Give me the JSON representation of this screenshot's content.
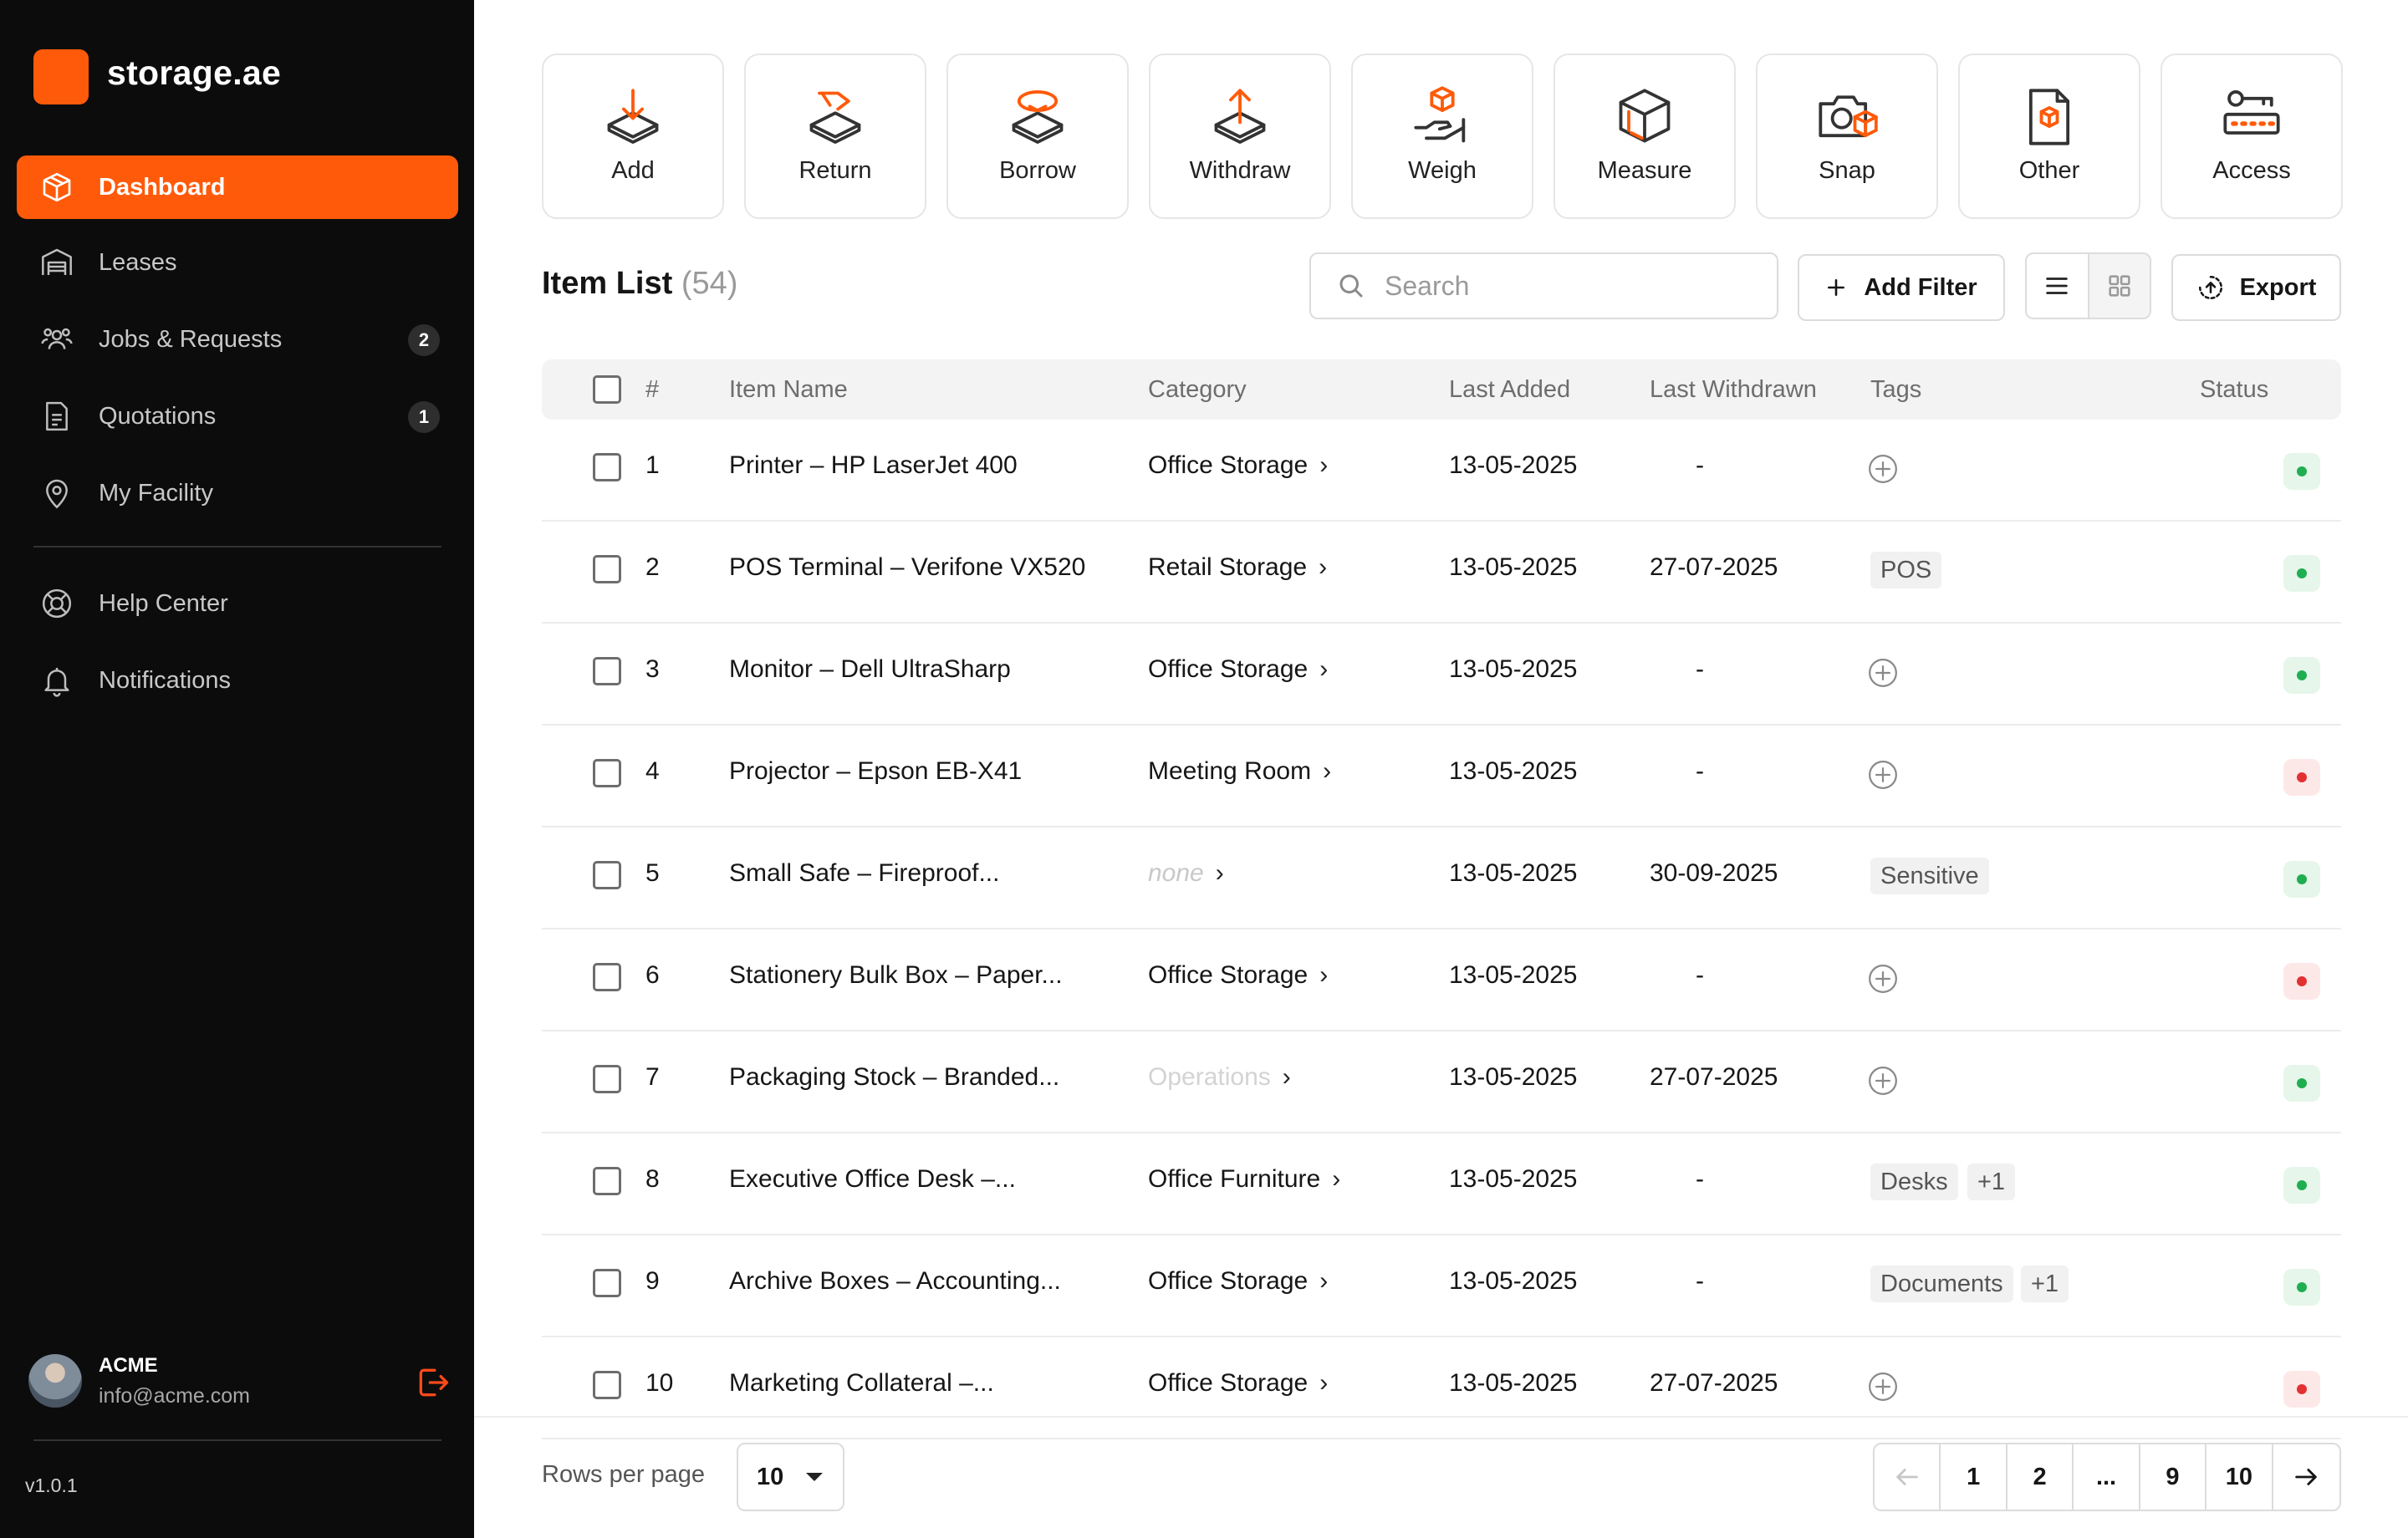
{
  "brand": {
    "name": "storage.ae",
    "accent": "#ff5a0a"
  },
  "sidebar": {
    "items": [
      {
        "label": "Dashboard",
        "icon": "box-icon",
        "active": true
      },
      {
        "label": "Leases",
        "icon": "warehouse-icon"
      },
      {
        "label": "Jobs & Requests",
        "icon": "people-icon",
        "badge": "2"
      },
      {
        "label": "Quotations",
        "icon": "document-icon",
        "badge": "1"
      },
      {
        "label": "My Facility",
        "icon": "location-pin-icon"
      }
    ],
    "secondary": [
      {
        "label": "Help Center",
        "icon": "lifebuoy-icon"
      },
      {
        "label": "Notifications",
        "icon": "bell-icon"
      }
    ],
    "user": {
      "name": "ACME",
      "email": "info@acme.com"
    },
    "version": "v1.0.1"
  },
  "actions": [
    {
      "label": "Add",
      "icon": "add-box-icon"
    },
    {
      "label": "Return",
      "icon": "return-icon"
    },
    {
      "label": "Borrow",
      "icon": "borrow-icon"
    },
    {
      "label": "Withdraw",
      "icon": "withdraw-icon"
    },
    {
      "label": "Weigh",
      "icon": "weigh-icon"
    },
    {
      "label": "Measure",
      "icon": "measure-icon"
    },
    {
      "label": "Snap",
      "icon": "camera-icon"
    },
    {
      "label": "Other",
      "icon": "other-document-icon"
    },
    {
      "label": "Access",
      "icon": "key-icon"
    }
  ],
  "list": {
    "title": "Item List",
    "count": "(54)",
    "search_placeholder": "Search",
    "add_filter_label": "Add Filter",
    "export_label": "Export",
    "columns": [
      "#",
      "Item Name",
      "Category",
      "Last Added",
      "Last Withdrawn",
      "Tags",
      "Status"
    ],
    "rows": [
      {
        "num": "1",
        "name": "Printer – HP LaserJet 400",
        "category": "Office Storage",
        "category_style": "normal",
        "added": "13-05-2025",
        "withdrawn": "-",
        "tags": [],
        "status": "ok"
      },
      {
        "num": "2",
        "name": "POS Terminal – Verifone VX520",
        "category": "Retail Storage",
        "category_style": "normal",
        "added": "13-05-2025",
        "withdrawn": "27-07-2025",
        "tags": [
          "POS"
        ],
        "status": "ok"
      },
      {
        "num": "3",
        "name": "Monitor – Dell UltraSharp",
        "category": "Office Storage",
        "category_style": "normal",
        "added": "13-05-2025",
        "withdrawn": "-",
        "tags": [],
        "status": "ok"
      },
      {
        "num": "4",
        "name": "Projector – Epson EB-X41",
        "category": "Meeting Room",
        "category_style": "normal",
        "added": "13-05-2025",
        "withdrawn": "-",
        "tags": [],
        "status": "bad"
      },
      {
        "num": "5",
        "name": "Small Safe – Fireproof...",
        "category": "none",
        "category_style": "muted",
        "added": "13-05-2025",
        "withdrawn": "30-09-2025",
        "tags": [
          "Sensitive"
        ],
        "status": "ok"
      },
      {
        "num": "6",
        "name": "Stationery Bulk Box – Paper...",
        "category": "Office Storage",
        "category_style": "normal",
        "added": "13-05-2025",
        "withdrawn": "-",
        "tags": [],
        "status": "bad"
      },
      {
        "num": "7",
        "name": "Packaging Stock – Branded...",
        "category": "Operations",
        "category_style": "faint",
        "added": "13-05-2025",
        "withdrawn": "27-07-2025",
        "tags": [],
        "status": "ok"
      },
      {
        "num": "8",
        "name": "Executive Office Desk –...",
        "category": "Office Furniture",
        "category_style": "normal",
        "added": "13-05-2025",
        "withdrawn": "-",
        "tags": [
          "Desks",
          "+1"
        ],
        "status": "ok"
      },
      {
        "num": "9",
        "name": "Archive Boxes – Accounting...",
        "category": "Office Storage",
        "category_style": "normal",
        "added": "13-05-2025",
        "withdrawn": "-",
        "tags": [
          "Documents",
          "+1"
        ],
        "status": "ok"
      },
      {
        "num": "10",
        "name": "Marketing Collateral –...",
        "category": "Office Storage",
        "category_style": "normal",
        "added": "13-05-2025",
        "withdrawn": "27-07-2025",
        "tags": [],
        "status": "bad"
      }
    ]
  },
  "footer": {
    "rows_per_page_label": "Rows per page",
    "rows_per_page_value": "10",
    "pages": [
      "1",
      "2",
      "...",
      "9",
      "10"
    ],
    "current_page": "1"
  },
  "colors": {
    "status_ok": "#1fae50",
    "status_bad": "#e23131"
  }
}
